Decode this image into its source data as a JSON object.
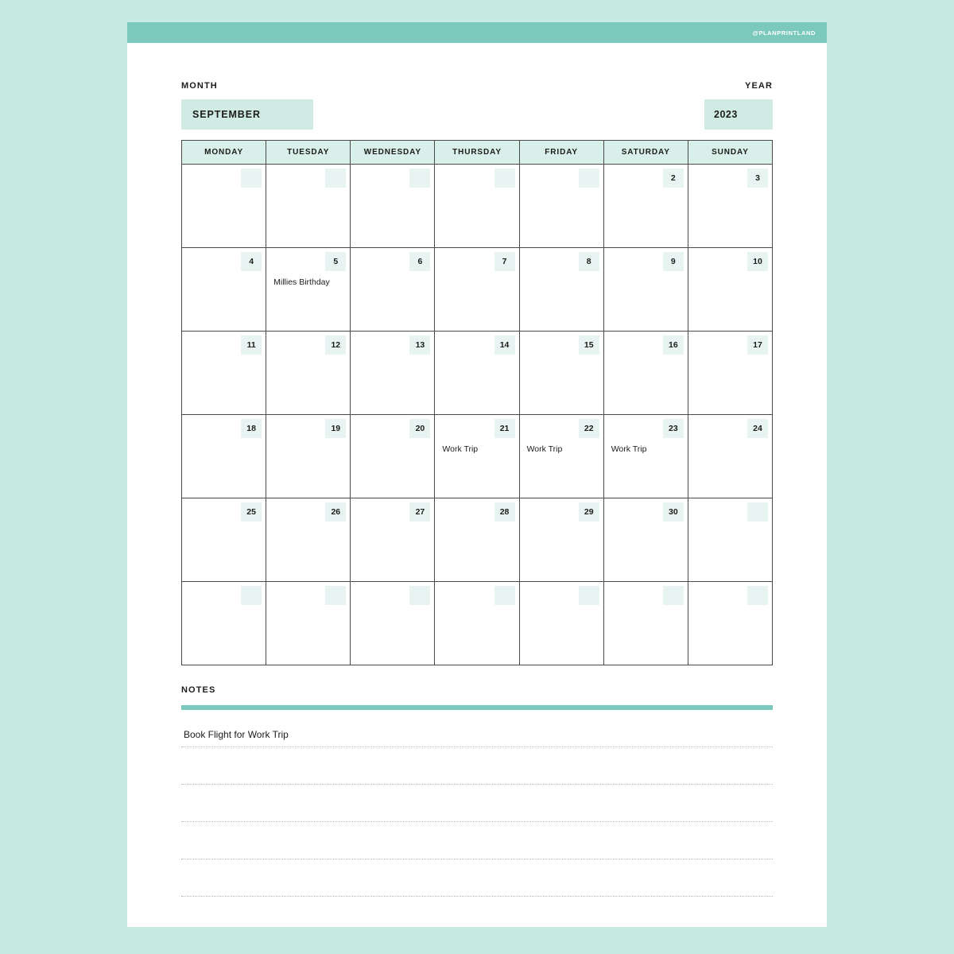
{
  "brand": {
    "handle": "@PLANPRINTLAND"
  },
  "fields": {
    "month_label": "MONTH",
    "month_value": "SEPTEMBER",
    "year_label": "YEAR",
    "year_value": "2023"
  },
  "calendar": {
    "weekday_headers": [
      "MONDAY",
      "TUESDAY",
      "WEDNESDAY",
      "THURSDAY",
      "FRIDAY",
      "SATURDAY",
      "SUNDAY"
    ],
    "weeks": [
      [
        {
          "day": "",
          "event": ""
        },
        {
          "day": "",
          "event": ""
        },
        {
          "day": "",
          "event": ""
        },
        {
          "day": "",
          "event": ""
        },
        {
          "day": "",
          "event": ""
        },
        {
          "day": "2",
          "event": ""
        },
        {
          "day": "3",
          "event": ""
        }
      ],
      [
        {
          "day": "4",
          "event": ""
        },
        {
          "day": "5",
          "event": "Millies Birthday"
        },
        {
          "day": "6",
          "event": ""
        },
        {
          "day": "7",
          "event": ""
        },
        {
          "day": "8",
          "event": ""
        },
        {
          "day": "9",
          "event": ""
        },
        {
          "day": "10",
          "event": ""
        }
      ],
      [
        {
          "day": "11",
          "event": ""
        },
        {
          "day": "12",
          "event": ""
        },
        {
          "day": "13",
          "event": ""
        },
        {
          "day": "14",
          "event": ""
        },
        {
          "day": "15",
          "event": ""
        },
        {
          "day": "16",
          "event": ""
        },
        {
          "day": "17",
          "event": ""
        }
      ],
      [
        {
          "day": "18",
          "event": ""
        },
        {
          "day": "19",
          "event": ""
        },
        {
          "day": "20",
          "event": ""
        },
        {
          "day": "21",
          "event": "Work Trip"
        },
        {
          "day": "22",
          "event": "Work Trip"
        },
        {
          "day": "23",
          "event": "Work Trip"
        },
        {
          "day": "24",
          "event": ""
        }
      ],
      [
        {
          "day": "25",
          "event": ""
        },
        {
          "day": "26",
          "event": ""
        },
        {
          "day": "27",
          "event": ""
        },
        {
          "day": "28",
          "event": ""
        },
        {
          "day": "29",
          "event": ""
        },
        {
          "day": "30",
          "event": ""
        },
        {
          "day": "",
          "event": ""
        }
      ],
      [
        {
          "day": "",
          "event": ""
        },
        {
          "day": "",
          "event": ""
        },
        {
          "day": "",
          "event": ""
        },
        {
          "day": "",
          "event": ""
        },
        {
          "day": "",
          "event": ""
        },
        {
          "day": "",
          "event": ""
        },
        {
          "day": "",
          "event": ""
        }
      ]
    ]
  },
  "notes": {
    "title": "NOTES",
    "lines": [
      "Book Flight for Work Trip",
      "",
      "",
      "",
      ""
    ]
  },
  "colors": {
    "page_background": "#c6e9e1",
    "brand_teal": "#7bc8bd",
    "field_box": "#cfebe4",
    "weekday_header": "#d9efe9",
    "daynum_box": "#e8f4f1",
    "grid_border": "#4a4a4a",
    "text": "#1c1c1c"
  }
}
